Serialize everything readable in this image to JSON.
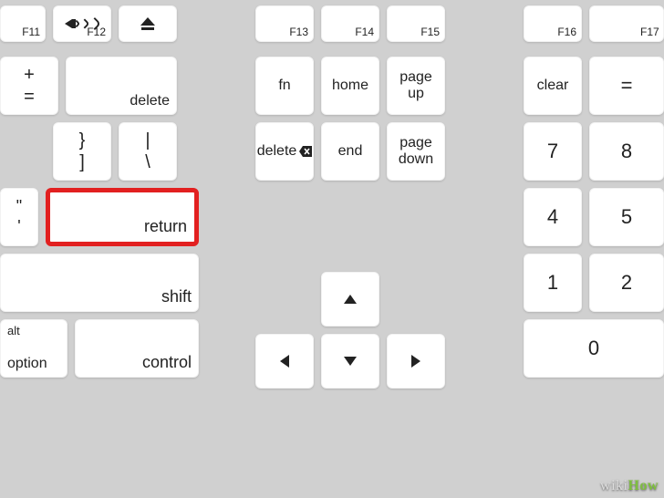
{
  "frow": {
    "f11": "F11",
    "f12": "F12",
    "f13": "F13",
    "f14": "F14",
    "f15": "F15",
    "f16": "F16",
    "f17": "F17"
  },
  "main": {
    "plus": "+",
    "equals": "=",
    "delete": "delete",
    "brace_close": "}",
    "bracket_close": "]",
    "pipe": "|",
    "backslash": "\\",
    "dquote": "\"",
    "squote": "'",
    "return": "return",
    "shift": "shift",
    "alt": "alt",
    "option": "option",
    "control": "control"
  },
  "nav": {
    "fn": "fn",
    "home": "home",
    "pageup1": "page",
    "pageup2": "up",
    "delete": "delete",
    "end": "end",
    "pagedown1": "page",
    "pagedown2": "down"
  },
  "numpad": {
    "clear": "clear",
    "equals": "=",
    "n7": "7",
    "n8": "8",
    "n4": "4",
    "n5": "5",
    "n1": "1",
    "n2": "2",
    "n0": "0"
  },
  "watermark": {
    "wiki": "wiki",
    "how": "How"
  }
}
